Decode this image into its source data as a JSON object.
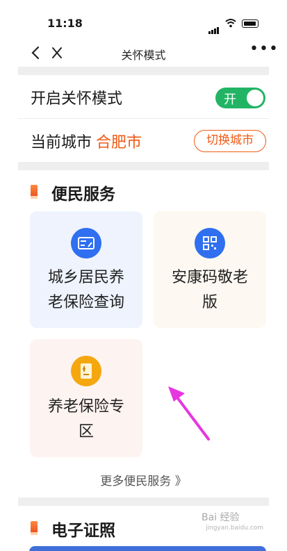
{
  "status_bar": {
    "time": "11:18"
  },
  "nav": {
    "title": "关怀模式",
    "more": "•••"
  },
  "care_mode": {
    "label": "开启关怀模式",
    "toggle_text": "开",
    "enabled": true
  },
  "city": {
    "label": "当前城市",
    "name": "合肥市",
    "switch_label": "切换城市"
  },
  "services": {
    "title": "便民服务",
    "items": [
      {
        "line1": "城乡居民养",
        "line2": "老保险查询",
        "icon": "card-icon",
        "color": "#2f6ff0",
        "bg": "#eef3fd"
      },
      {
        "line1": "安康码敬老",
        "line2": "版",
        "icon": "qr-code-icon",
        "color": "#2f6ff0",
        "bg": "#fdf8f1"
      },
      {
        "line1": "养老保险专",
        "line2": "区",
        "icon": "document-icon",
        "color": "#f5a70f",
        "bg": "#fdf3f1"
      }
    ],
    "more_label": "更多便民服务 》"
  },
  "certificates": {
    "title": "电子证照"
  },
  "watermark": {
    "line1": "Bai 经验",
    "line2": "jingyan.baidu.com"
  },
  "colors": {
    "accent": "#f05a14",
    "toggle_on": "#22b464",
    "arrow": "#e636e0"
  }
}
